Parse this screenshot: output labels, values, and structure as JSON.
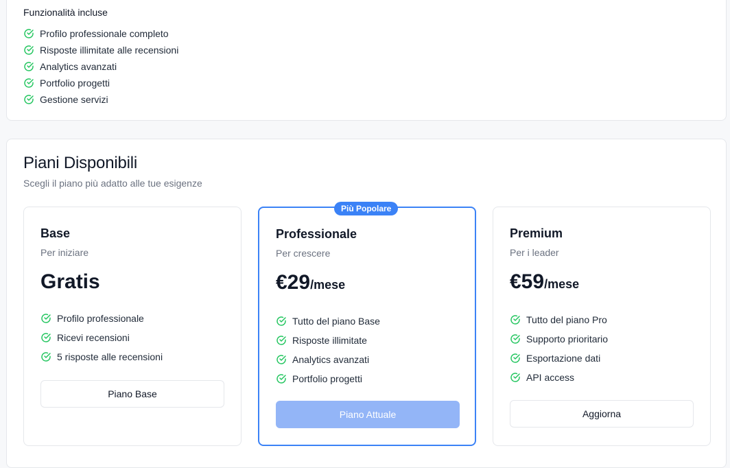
{
  "features_included": {
    "title": "Funzionalità incluse",
    "items": [
      "Profilo professionale completo",
      "Risposte illimitate alle recensioni",
      "Analytics avanzati",
      "Portfolio progetti",
      "Gestione servizi"
    ]
  },
  "plans_section": {
    "title": "Piani Disponibili",
    "subtitle": "Scegli il piano più adatto alle tue esigenze",
    "popular_badge": "Più Popolare",
    "plans": [
      {
        "name": "Base",
        "description": "Per iniziare",
        "price": "Gratis",
        "period": "",
        "features": [
          "Profilo professionale",
          "Ricevi recensioni",
          "5 risposte alle recensioni"
        ],
        "button_label": "Piano Base"
      },
      {
        "name": "Professionale",
        "description": "Per crescere",
        "price": "€29",
        "period": "/mese",
        "features": [
          "Tutto del piano Base",
          "Risposte illimitate",
          "Analytics avanzati",
          "Portfolio progetti"
        ],
        "button_label": "Piano Attuale"
      },
      {
        "name": "Premium",
        "description": "Per i leader",
        "price": "€59",
        "period": "/mese",
        "features": [
          "Tutto del piano Pro",
          "Supporto prioritario",
          "Esportazione dati",
          "API access"
        ],
        "button_label": "Aggiorna"
      }
    ]
  },
  "colors": {
    "accent": "#3b82f6",
    "check_green": "#22c55e",
    "disabled_button": "#93b5f7"
  },
  "icons": {
    "feature_check": "circle-check-icon"
  }
}
